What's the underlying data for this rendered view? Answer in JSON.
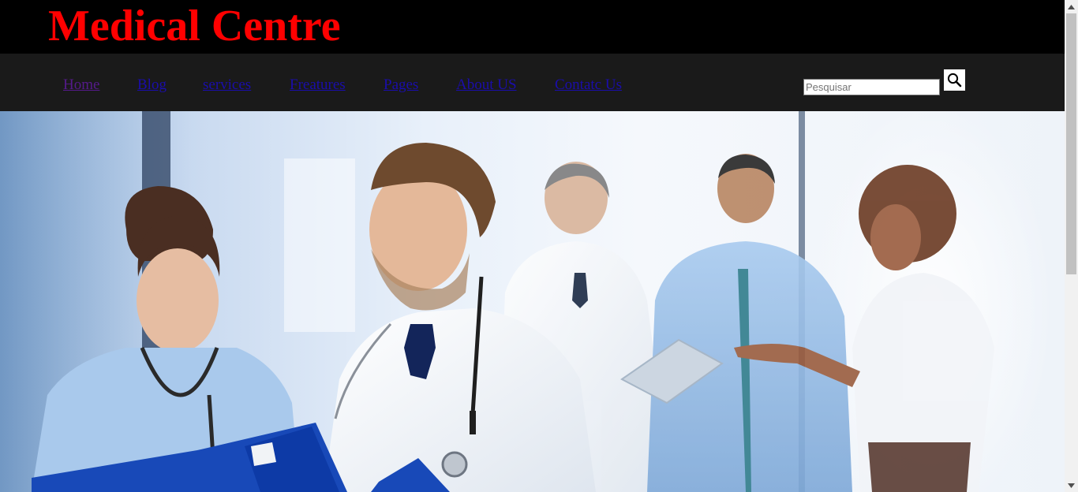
{
  "header": {
    "title": "Medical Centre"
  },
  "nav": {
    "items": [
      {
        "label": "Home"
      },
      {
        "label": "Blog"
      },
      {
        "label": "services"
      },
      {
        "label": "Freatures"
      },
      {
        "label": "Pages"
      },
      {
        "label": "About US"
      },
      {
        "label": "Contatc Us"
      }
    ]
  },
  "search": {
    "placeholder": "Pesquisar",
    "button_icon": "search-icon"
  },
  "hero": {
    "image": "medical-team-photo"
  },
  "colors": {
    "title": "#ff0000",
    "header_bg": "#000000",
    "nav_bg": "#1a1a1a",
    "link": "#1a0dab",
    "link_visited": "#551a8b"
  }
}
